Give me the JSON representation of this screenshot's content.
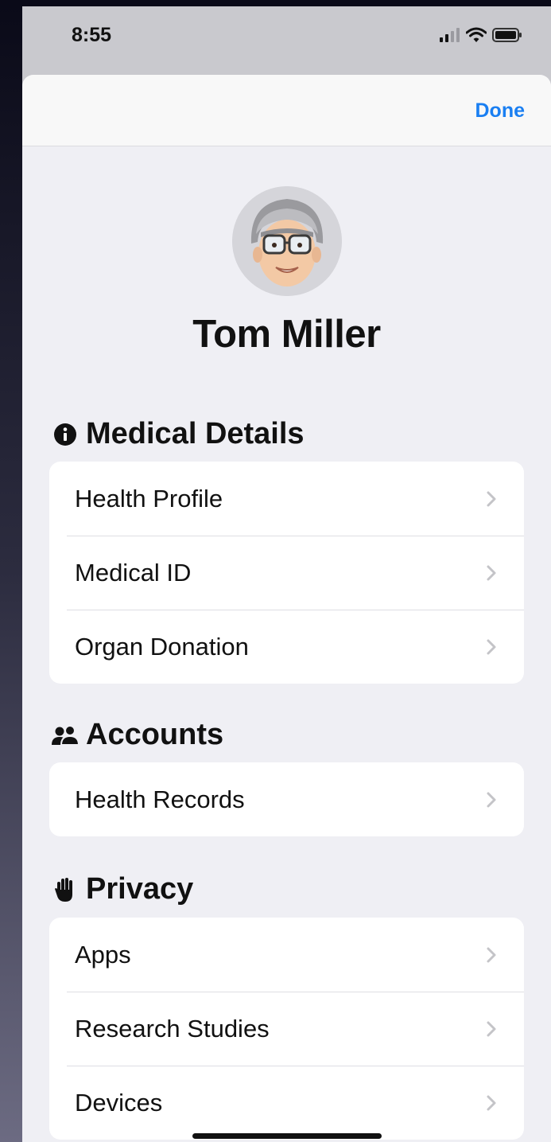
{
  "status_bar": {
    "time": "8:55"
  },
  "nav": {
    "done_label": "Done"
  },
  "profile": {
    "name": "Tom Miller"
  },
  "sections": [
    {
      "title": "Medical Details",
      "icon": "info-circle-icon",
      "items": [
        "Health Profile",
        "Medical ID",
        "Organ Donation"
      ]
    },
    {
      "title": "Accounts",
      "icon": "people-icon",
      "items": [
        "Health Records"
      ]
    },
    {
      "title": "Privacy",
      "icon": "hand-icon",
      "items": [
        "Apps",
        "Research Studies",
        "Devices"
      ]
    }
  ],
  "colors": {
    "accent": "#1a7ff2",
    "background": "#efeff4",
    "card": "#ffffff"
  }
}
